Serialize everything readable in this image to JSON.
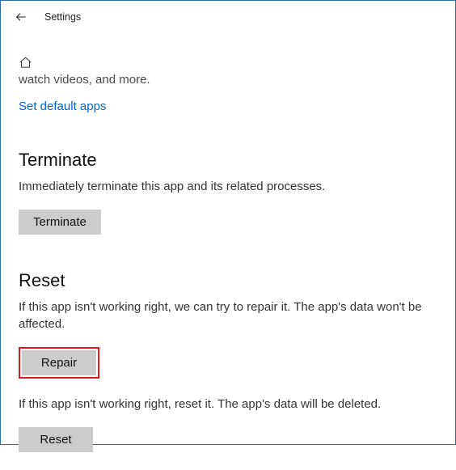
{
  "titlebar": {
    "title": "Settings"
  },
  "cutoff_text": "watch videos, and more.",
  "link_text": "Set default apps",
  "terminate": {
    "heading": "Terminate",
    "desc": "Immediately terminate this app and its related processes.",
    "button": "Terminate"
  },
  "reset": {
    "heading": "Reset",
    "repair_desc": "If this app isn't working right, we can try to repair it. The app's data won't be affected.",
    "repair_button": "Repair",
    "reset_desc": "If this app isn't working right, reset it. The app's data will be deleted.",
    "reset_button": "Reset"
  }
}
